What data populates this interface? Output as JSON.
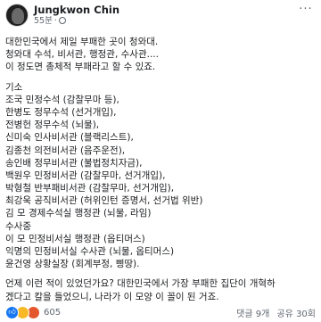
{
  "post": {
    "author": "Jungkwon Chin",
    "time": "55분",
    "separator": "·",
    "more_label": "···",
    "lines": [
      "대한민국에서 제일 부패한 곳이 청와대.",
      "청와대 수석, 비서관, 행정관, 수사관....",
      "이 정도면 총체적 부패라고 할 수 있죠.",
      "",
      "기소",
      "조국 민정수석 (감찰무마 등),",
      "한병도 정무수석 (선거개입),",
      "전병헌 정무수석 (뇌물),",
      "신미숙 인사비서관 (블랙리스트),",
      "김종천 의전비서관 (음주운전),",
      "송인배 정무비서관 (불법정치자금),",
      "백원우 민정비서관 (감찰무마, 선거개입),",
      "박형철 반부패비서관 (감찰무마, 선거개입),",
      "최강욱 공직비서관 (허위인턴 증명서, 선거법 위반)",
      "김 모 경제수석실 행정관 (뇌물, 라임)",
      "수사중",
      "이 모 민정비서실 행정관 (옵티머스)",
      "익명의 민정비서실 수사관 (뇌물, 옵티머스)",
      "윤건영 상황실장 (회계부정, 삥땅).",
      "",
      "언제 이런 적이 있었던가요? 대한민국에서 가장 부패한 집단이 개혁하",
      "겠다고 칼을 들었으니, 나라가 이 모양 이 꼴이 된 거죠."
    ]
  },
  "footer": {
    "reaction_icons": [
      "like-icon",
      "haha-icon",
      "angry-icon"
    ],
    "reaction_count": "605",
    "comments": "댓글 9개",
    "shares": "공유 30회"
  },
  "colors": {
    "text": "#1c1e21",
    "meta": "#606770",
    "like": "#1877f2",
    "haha": "#f7b928",
    "angry": "#e4572e"
  }
}
